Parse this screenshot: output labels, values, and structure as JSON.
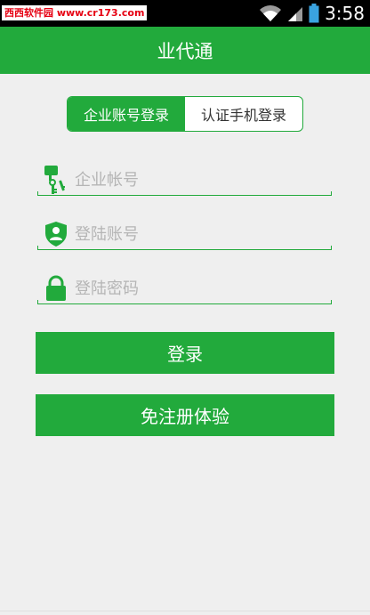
{
  "status_bar": {
    "watermark": "西西软件园 www.cr173.com",
    "time": "3:58"
  },
  "app_bar": {
    "title": "业代通"
  },
  "login_tabs": [
    {
      "label": "企业账号登录",
      "active": true
    },
    {
      "label": "认证手机登录",
      "active": false
    }
  ],
  "form": {
    "company_account": {
      "placeholder": "企业帐号",
      "value": "",
      "icon": "keys-icon"
    },
    "login_account": {
      "placeholder": "登陆账号",
      "value": "",
      "icon": "user-shield-icon"
    },
    "login_password": {
      "placeholder": "登陆密码",
      "value": "",
      "icon": "lock-icon"
    }
  },
  "buttons": {
    "login": "登录",
    "trial": "免注册体验"
  },
  "colors": {
    "primary": "#22aa3c",
    "background": "#efefef",
    "placeholder": "#b5b5b5"
  }
}
